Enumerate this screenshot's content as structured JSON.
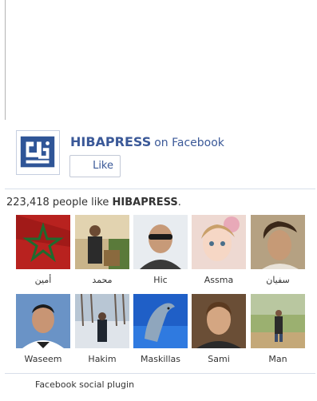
{
  "page": {
    "name": "HIBAPRESS",
    "on_facebook": "on Facebook",
    "like_button": "Like"
  },
  "likes": {
    "count": "223,418",
    "text_middle": " people like ",
    "page_name": "HIBAPRESS",
    "suffix": "."
  },
  "faces": [
    {
      "name": "أمين",
      "icon": "flag-avatar"
    },
    {
      "name": "محمد",
      "icon": "person-indoor-avatar"
    },
    {
      "name": "Hic",
      "icon": "man-sunglasses-avatar"
    },
    {
      "name": "Assma",
      "icon": "child-avatar"
    },
    {
      "name": "سفيان",
      "icon": "man-dark-hair-avatar"
    },
    {
      "name": "Waseem",
      "icon": "man-portrait-avatar"
    },
    {
      "name": "Hakim",
      "icon": "snow-scene-avatar"
    },
    {
      "name": "Maskillas",
      "icon": "dolphin-avatar"
    },
    {
      "name": "Sami",
      "icon": "man-portrait-avatar"
    },
    {
      "name": "Man",
      "icon": "outdoor-person-avatar"
    }
  ],
  "footer": {
    "plugin_label": "Facebook social plugin"
  },
  "colors": {
    "brand": "#3b5998",
    "divider": "#d8dfea"
  }
}
